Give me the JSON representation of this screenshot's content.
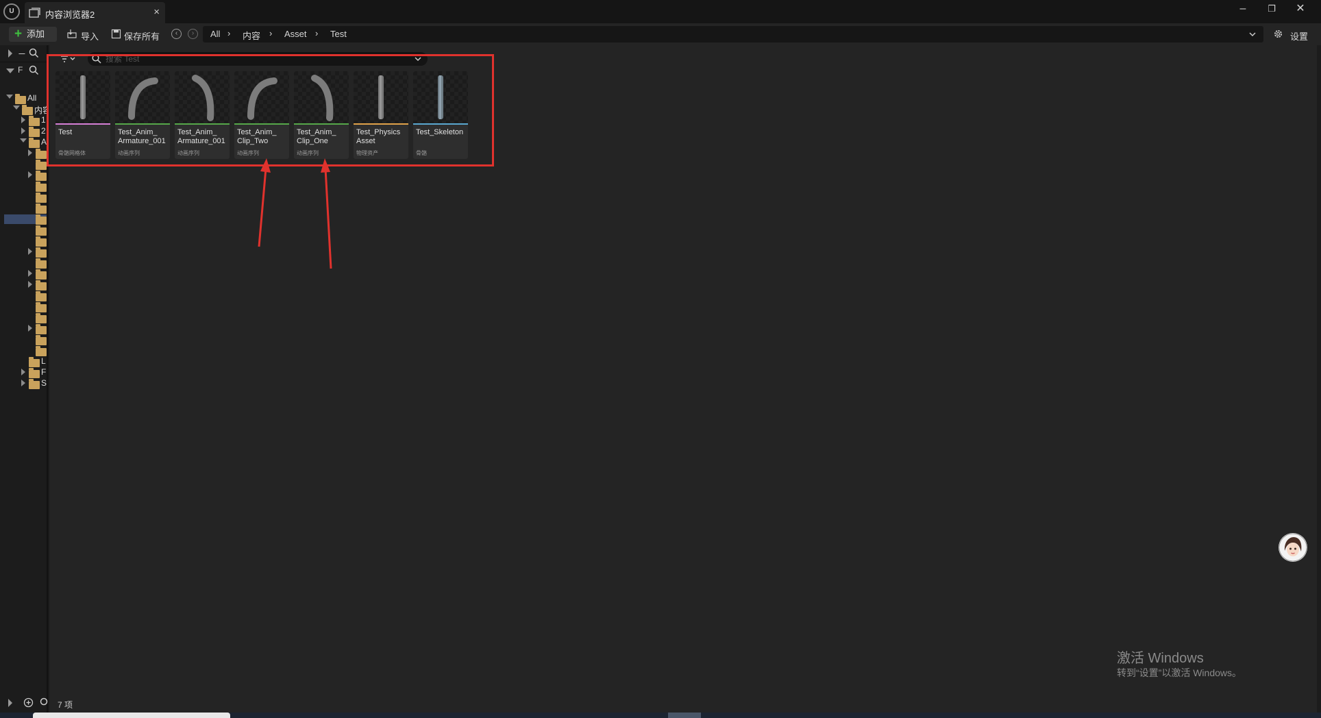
{
  "window": {
    "tab_title": "内容浏览器2",
    "tab_close": "×",
    "minimize": "–",
    "restore": "❐",
    "close": "✕"
  },
  "toolbar": {
    "add_label": "添加",
    "import_label": "导入",
    "save_all_label": "保存所有",
    "settings_label": "设置",
    "breadcrumb": [
      "All",
      "内容",
      "Asset",
      "Test"
    ],
    "breadcrumb_dropdown": "⌄"
  },
  "left_panel": {
    "collections_letter": "ㄧ",
    "favorites_letter": "F",
    "tree": {
      "all_label": "All",
      "content_label": "内容",
      "item_1": "1",
      "item_2": "2",
      "item_a": "A",
      "item_l": "L",
      "item_f": "F",
      "item_s": "S"
    }
  },
  "search": {
    "placeholder": "搜索 Test"
  },
  "assets": [
    {
      "name": "Test",
      "type": "骨骼网格体",
      "strip_color": "#d67fd6"
    },
    {
      "name": "Test_Anim_\nArmature_001",
      "type": "动画序列",
      "strip_color": "#56a84a"
    },
    {
      "name": "Test_Anim_\nArmature_001",
      "type": "动画序列",
      "strip_color": "#56a84a"
    },
    {
      "name": "Test_Anim_\nClip_Two",
      "type": "动画序列",
      "strip_color": "#56a84a"
    },
    {
      "name": "Test_Anim_\nClip_One",
      "type": "动画序列",
      "strip_color": "#56a84a"
    },
    {
      "name": "Test_Physics\nAsset",
      "type": "物理资产",
      "strip_color": "#e0a24a"
    },
    {
      "name": "Test_Skeleton",
      "type": "骨骼",
      "strip_color": "#5aa8d0"
    }
  ],
  "status": {
    "item_count": "7 项"
  },
  "watermark": {
    "title": "激活 Windows",
    "subtitle": "转到“设置”以激活 Windows。"
  },
  "colors": {
    "highlight": "#e0322d",
    "add_plus": "#3fbf3f",
    "folder": "#c9a25c"
  }
}
